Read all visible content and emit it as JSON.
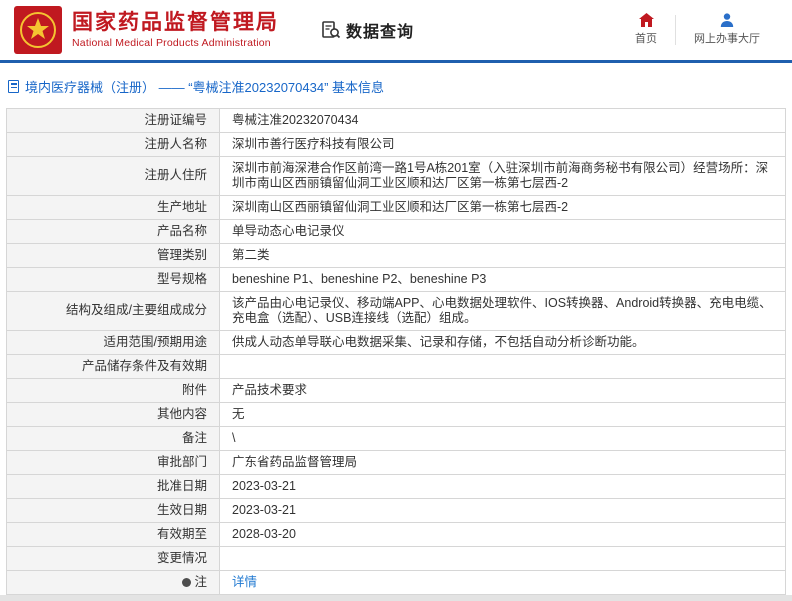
{
  "header": {
    "org_cn": "国家药品监督管理局",
    "org_en": "National Medical Products Administration",
    "query_label": "数据查询",
    "nav_home": "首页",
    "nav_service": "网上办事大厅"
  },
  "breadcrumb": {
    "text": "境内医疗器械（注册） ——  “粤械注准20232070434” 基本信息"
  },
  "accent_colors": {
    "brand_red": "#c01920",
    "line_blue": "#1f5fae",
    "link_blue": "#1f78d1"
  },
  "table": {
    "rows": [
      {
        "label": "注册证编号",
        "value": "粤械注准20232070434"
      },
      {
        "label": "注册人名称",
        "value": "深圳市善行医疗科技有限公司"
      },
      {
        "label": "注册人住所",
        "value": "深圳市前海深港合作区前湾一路1号A栋201室（入驻深圳市前海商务秘书有限公司）经营场所：深圳市南山区西丽镇留仙洞工业区顺和达厂区第一栋第七层西-2"
      },
      {
        "label": "生产地址",
        "value": "深圳南山区西丽镇留仙洞工业区顺和达厂区第一栋第七层西-2"
      },
      {
        "label": "产品名称",
        "value": "单导动态心电记录仪"
      },
      {
        "label": "管理类别",
        "value": "第二类"
      },
      {
        "label": "型号规格",
        "value": "beneshine P1、beneshine P2、beneshine P3"
      },
      {
        "label": "结构及组成/主要组成成分",
        "value": "该产品由心电记录仪、移动端APP、心电数据处理软件、IOS转换器、Android转换器、充电电缆、充电盒（选配）、USB连接线（选配）组成。"
      },
      {
        "label": "适用范围/预期用途",
        "value": "供成人动态单导联心电数据采集、记录和存储，不包括自动分析诊断功能。"
      },
      {
        "label": "产品储存条件及有效期",
        "value": ""
      },
      {
        "label": "附件",
        "value": "产品技术要求"
      },
      {
        "label": "其他内容",
        "value": "无"
      },
      {
        "label": "备注",
        "value": "\\"
      },
      {
        "label": "审批部门",
        "value": "广东省药品监督管理局"
      },
      {
        "label": "批准日期",
        "value": "2023-03-21"
      },
      {
        "label": "生效日期",
        "value": "2023-03-21"
      },
      {
        "label": "有效期至",
        "value": "2028-03-20"
      },
      {
        "label": "变更情况",
        "value": ""
      },
      {
        "label": "注",
        "value": "详情",
        "is_link": true,
        "has_icon": true
      }
    ]
  }
}
